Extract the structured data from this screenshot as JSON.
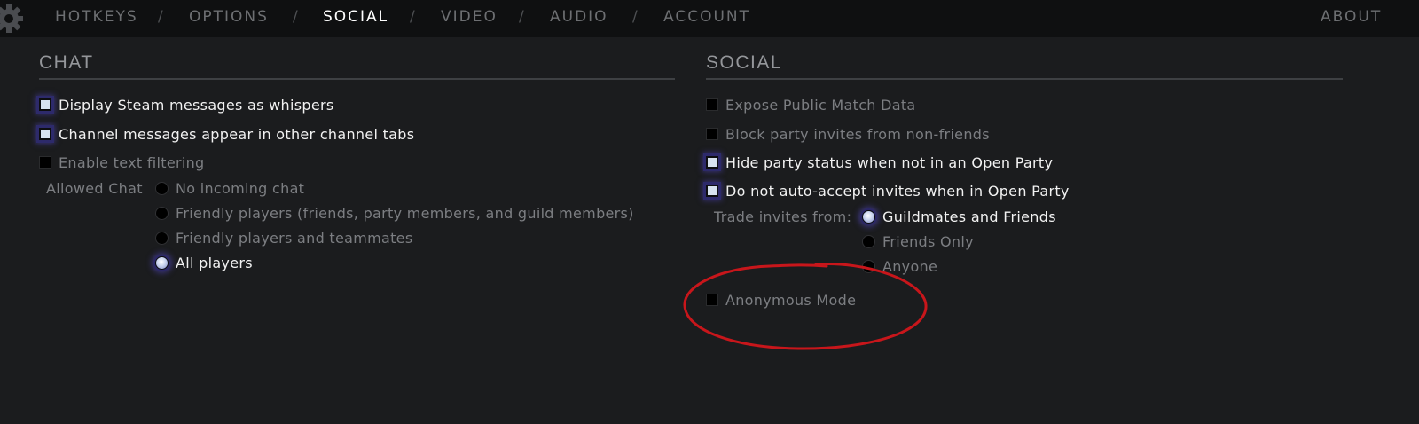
{
  "nav": {
    "items": [
      {
        "label": "HOTKEYS",
        "active": false
      },
      {
        "label": "OPTIONS",
        "active": false
      },
      {
        "label": "SOCIAL",
        "active": true
      },
      {
        "label": "VIDEO",
        "active": false
      },
      {
        "label": "AUDIO",
        "active": false
      },
      {
        "label": "ACCOUNT",
        "active": false
      }
    ],
    "separator": "/",
    "about_label": "ABOUT"
  },
  "chat": {
    "title": "CHAT",
    "options": [
      {
        "label": "Display Steam messages as whispers",
        "checked": true
      },
      {
        "label": "Channel messages appear in other channel tabs",
        "checked": true
      },
      {
        "label": "Enable text filtering",
        "checked": false
      }
    ],
    "allowed_chat": {
      "label": "Allowed Chat",
      "choices": [
        {
          "label": "No incoming chat",
          "selected": false
        },
        {
          "label": "Friendly players (friends, party members, and guild members)",
          "selected": false
        },
        {
          "label": "Friendly players and teammates",
          "selected": false
        },
        {
          "label": "All players",
          "selected": true
        }
      ]
    }
  },
  "social": {
    "title": "SOCIAL",
    "options": [
      {
        "label": "Expose Public Match Data",
        "checked": false
      },
      {
        "label": "Block party invites from non-friends",
        "checked": false
      },
      {
        "label": "Hide party status when not in an Open Party",
        "checked": true
      },
      {
        "label": "Do not auto-accept invites when in Open Party",
        "checked": true
      }
    ],
    "trade_invites": {
      "label": "Trade invites from:",
      "choices": [
        {
          "label": "Guildmates and Friends",
          "selected": true
        },
        {
          "label": "Friends Only",
          "selected": false
        },
        {
          "label": "Anyone",
          "selected": false
        }
      ]
    },
    "anonymous_mode": {
      "label": "Anonymous Mode",
      "checked": false
    }
  },
  "icons": {
    "settings": "gear-icon"
  },
  "colors": {
    "background": "#1b1c1e",
    "topbar": "#0f1011",
    "active_tab": "#ffffff",
    "inactive_tab": "#6d6f72",
    "checked_glow": "#2d2a6b",
    "annotation_circle": "#c8161b"
  }
}
